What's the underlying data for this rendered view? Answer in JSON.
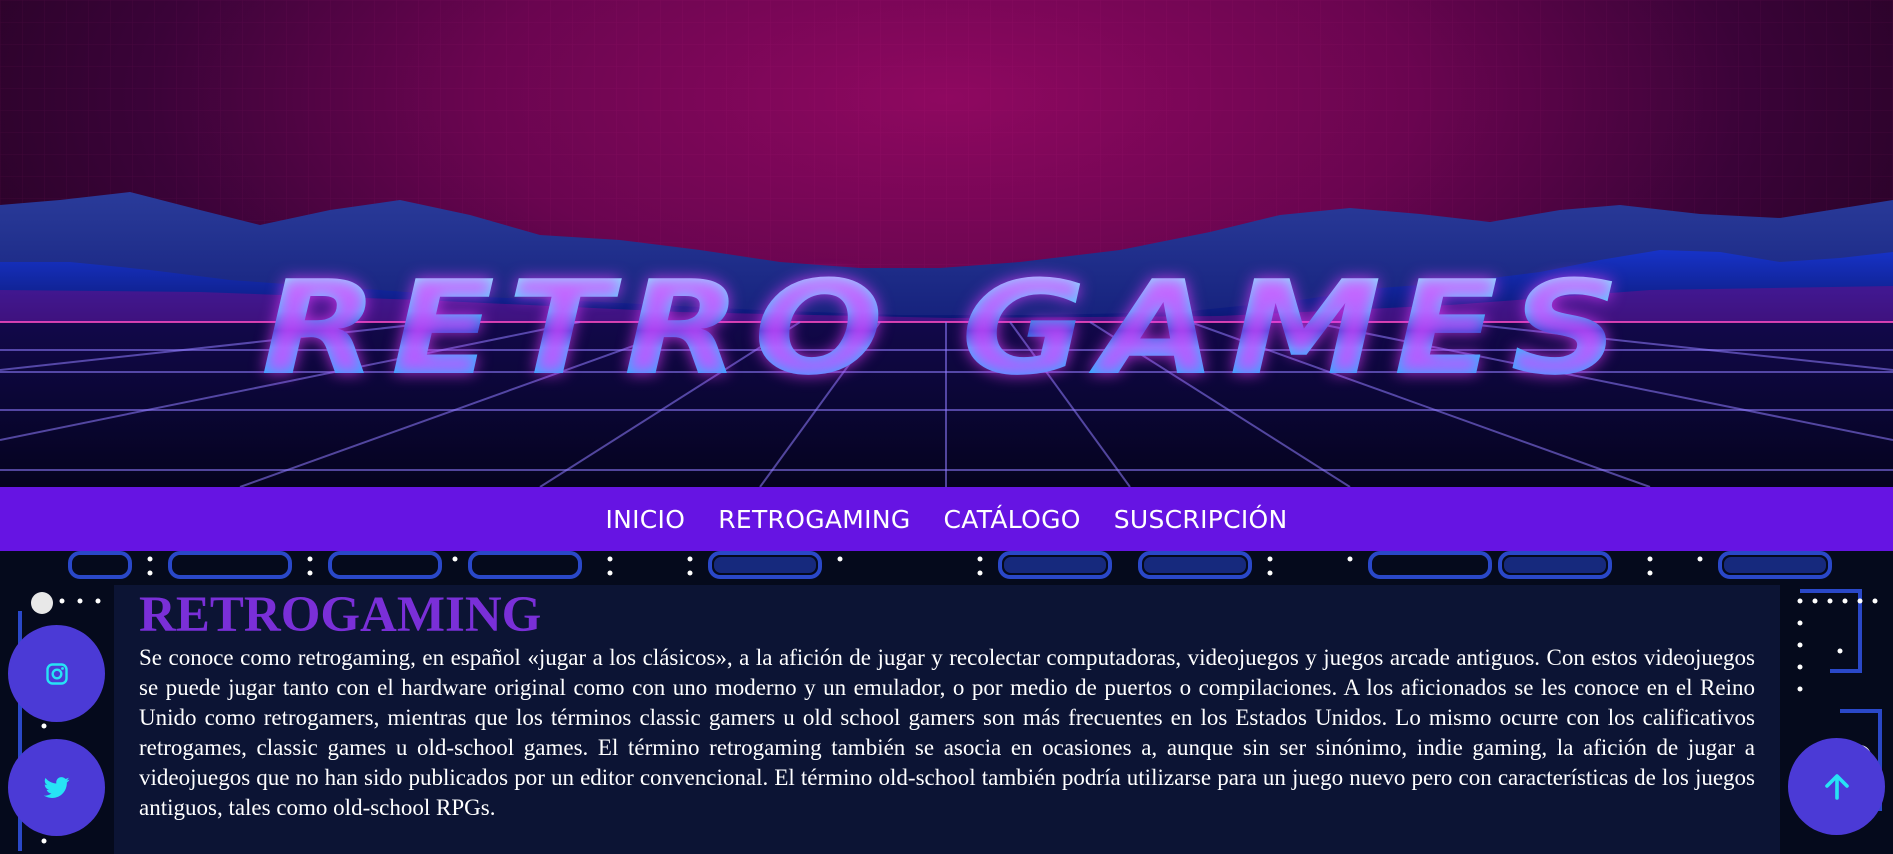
{
  "hero": {
    "title": "RETRO GAMES"
  },
  "nav": {
    "items": [
      {
        "label": "INICIO"
      },
      {
        "label": "RETROGAMING"
      },
      {
        "label": "CATÁLOGO"
      },
      {
        "label": "SUSCRIPCIÓN"
      }
    ]
  },
  "article": {
    "heading": "RETROGAMING",
    "body": "Se conoce como retrogaming, en español «jugar a los clásicos», a la afición de jugar y recolectar computadoras, videojuegos y juegos arcade antiguos. Con estos videojuegos se puede jugar tanto con el hardware original como con uno moderno y un emulador, o por medio de puertos o compilaciones. A los aficionados se les conoce en el Reino Unido como retrogamers, mientras que los términos classic gamers u old school gamers son más frecuentes en los Estados Unidos. Lo mismo ocurre con los calificativos retrogames, classic games u old-school games. El término retrogaming también se asocia en ocasiones a, aunque sin ser sinónimo, indie gaming, la afición de jugar a videojuegos que no han sido publicados por un editor convencional. El término old-school también podría utilizarse para un juego nuevo pero con características de los juegos antiguos, tales como old-school RPGs."
  },
  "floating_buttons": {
    "instagram": {
      "icon": "instagram-icon"
    },
    "twitter": {
      "icon": "twitter-icon"
    },
    "scroll_top": {
      "icon": "arrow-up-icon"
    }
  },
  "colors": {
    "nav_bg": "#6614e3",
    "heading": "#7a2fd8",
    "panel_bg": "#0c1434",
    "fab_bg": "#4b3ad6",
    "icon_cyan": "#27e3f5",
    "title_cyan": "#22d4ff",
    "hero_magenta": "#8e0860"
  }
}
